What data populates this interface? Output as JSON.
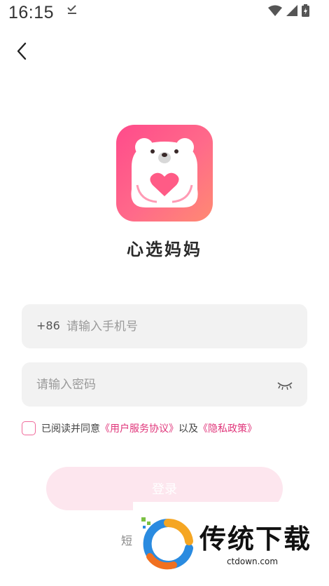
{
  "status_bar": {
    "time": "16:15"
  },
  "app": {
    "name": "心选妈妈"
  },
  "phone": {
    "country_code": "+86",
    "placeholder": "请输入手机号",
    "value": ""
  },
  "password": {
    "placeholder": "请输入密码",
    "value": ""
  },
  "agreement": {
    "prefix": "已阅读并同意",
    "user_agreement": "《用户服务协议》",
    "conjunction": "以及",
    "privacy_policy": "《隐私政策》"
  },
  "login_button": {
    "label": "登录"
  },
  "sms_login_partial": "短",
  "watermark": {
    "text": "传统下载",
    "url": "ctdown.com"
  },
  "colors": {
    "accent": "#e0357a",
    "logo_start": "#ff4b8b",
    "logo_end": "#ff8a72",
    "button_disabled": "#fde6ee"
  }
}
